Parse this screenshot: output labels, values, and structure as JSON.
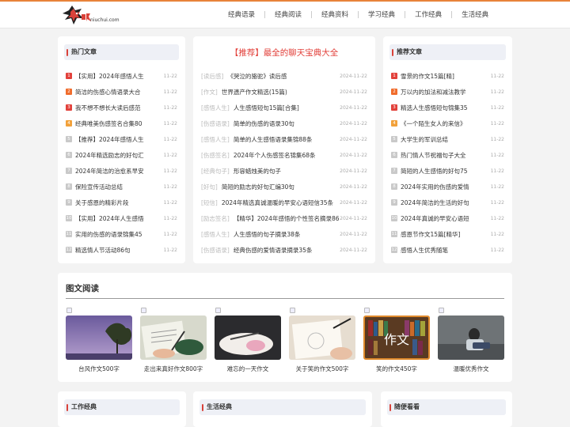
{
  "header": {
    "domain": "niuchui.com",
    "nav": [
      "经典语录",
      "经典阅读",
      "经典资料",
      "学习经典",
      "工作经典",
      "生活经典"
    ]
  },
  "hot": {
    "title": "热门文章",
    "items": [
      {
        "n": "1",
        "t": "【实用】2024年感悟人生",
        "d": "11-22"
      },
      {
        "n": "2",
        "t": "简洁的伤感心情语录大合",
        "d": "11-22"
      },
      {
        "n": "3",
        "t": "我不想不想长大读后感范",
        "d": "11-22"
      },
      {
        "n": "4",
        "t": "经典唯美伤感签名合集80",
        "d": "11-22"
      },
      {
        "n": "5",
        "t": "【推荐】2024年感悟人生",
        "d": "11-22"
      },
      {
        "n": "6",
        "t": "2024年精选励志的好句汇",
        "d": "11-22"
      },
      {
        "n": "7",
        "t": "2024年简洁的治愈系早安",
        "d": "11-22"
      },
      {
        "n": "8",
        "t": "保险宣传活动总结",
        "d": "11-22"
      },
      {
        "n": "9",
        "t": "关于感恩的精彩片段",
        "d": "11-22"
      },
      {
        "n": "10",
        "t": "【实用】2024年人生感悟",
        "d": "11-22"
      },
      {
        "n": "11",
        "t": "实用的伤感的语录锦集45",
        "d": "11-22"
      },
      {
        "n": "12",
        "t": "精选情人节活动86句",
        "d": "11-22"
      }
    ]
  },
  "featured": {
    "headline": "【推荐】最全的聊天宝典大全",
    "items": [
      {
        "c": "[读后感]",
        "t": "《哭泣的骆驼》读后感",
        "d": "2024-11-22"
      },
      {
        "c": "[作文]",
        "t": "世界遗产作文精选(15篇)",
        "d": "2024-11-22"
      },
      {
        "c": "[感悟人生]",
        "t": "人生感悟短句15篇[合集]",
        "d": "2024-11-22"
      },
      {
        "c": "[伤感语录]",
        "t": "简单的伤感的语录30句",
        "d": "2024-11-22"
      },
      {
        "c": "[感悟人生]",
        "t": "简单的人生感悟语录集锦88条",
        "d": "2024-11-22"
      },
      {
        "c": "[伤感签名]",
        "t": "2024年个人伤感签名锦集68条",
        "d": "2024-11-22"
      },
      {
        "c": "[经典句子]",
        "t": "形容蜡烛美的句子",
        "d": "2024-11-22"
      },
      {
        "c": "[好句]",
        "t": "简短的励志的好句汇编30句",
        "d": "2024-11-22"
      },
      {
        "c": "[短信]",
        "t": "2024年精选真诚温暖的早安心语短信35条",
        "d": "2024-11-22"
      },
      {
        "c": "[励志签名]",
        "t": "【精华】2024年感悟的个性签名摘录86",
        "d": "2024-11-22"
      },
      {
        "c": "[感悟人生]",
        "t": "人生感悟的句子摘录38条",
        "d": "2024-11-22"
      },
      {
        "c": "[伤感语录]",
        "t": "经典伤感的爱情语录摘录35条",
        "d": "2024-11-22"
      }
    ]
  },
  "recommend": {
    "title": "推荐文章",
    "items": [
      {
        "n": "1",
        "t": "雪景的作文15篇[精]",
        "d": "11-22"
      },
      {
        "n": "2",
        "t": "万以内的加法和减法教学",
        "d": "11-22"
      },
      {
        "n": "3",
        "t": "精选人生感悟短句锦集35",
        "d": "11-22"
      },
      {
        "n": "4",
        "t": "《一个陌生女人的来信》",
        "d": "11-22"
      },
      {
        "n": "5",
        "t": "大学生的军训总结",
        "d": "11-22"
      },
      {
        "n": "6",
        "t": "热门情人节祝福句子大全",
        "d": "11-22"
      },
      {
        "n": "7",
        "t": "简短的人生感悟的好句75",
        "d": "11-22"
      },
      {
        "n": "8",
        "t": "2024年实用的伤感的爱情",
        "d": "11-22"
      },
      {
        "n": "9",
        "t": "2024年简洁的生活的好句",
        "d": "11-22"
      },
      {
        "n": "10",
        "t": "2024年真诚的早安心语短",
        "d": "11-22"
      },
      {
        "n": "11",
        "t": "感恩节作文15篇[精华]",
        "d": "11-22"
      },
      {
        "n": "12",
        "t": "感悟人生优秀随笔",
        "d": "11-22"
      }
    ]
  },
  "gallery": {
    "title": "图文阅读",
    "items": [
      "台风作文500字",
      "走出来真好作文800字",
      "难忘的一天作文",
      "关于笑的作文500字",
      "笑的作文450字",
      "温暖优秀作文"
    ],
    "thumb_word": "作文"
  },
  "bottom": {
    "work": "工作经典",
    "life": "生活经典",
    "random": "随便看看"
  }
}
